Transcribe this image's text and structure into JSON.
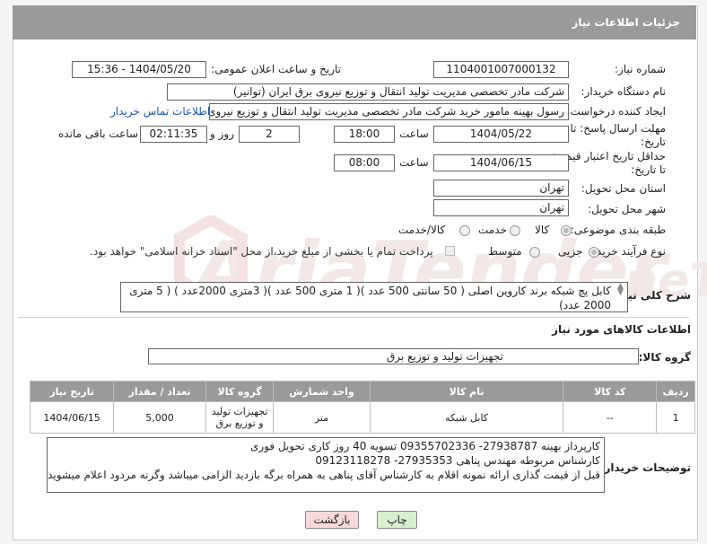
{
  "header": {
    "title": "جزئیات اطلاعات نیاز"
  },
  "form": {
    "need_number": {
      "label": "شماره نیاز:",
      "value": "1104001007000132"
    },
    "announce": {
      "label": "تاریخ و ساعت اعلان عمومی:",
      "value": "1404/05/20 - 15:36"
    },
    "buyer_org": {
      "label": "نام دستگاه خریدار:",
      "value": "شرکت مادر تخصصی مدیریت تولید  انتقال و توزیع نیروی برق ایران (توانیر)"
    },
    "requester": {
      "label": "ایجاد کننده درخواست:",
      "value": "رسول بهینه مامور خرید شرکت مادر تخصصی مدیریت تولید  انتقال و توزیع نیروی",
      "contact_link": "اطلاعات تماس خریدار"
    },
    "deadline": {
      "label_line1": "مهلت ارسال پاسخ: تا",
      "label_line2": "تاریخ:",
      "date": "1404/05/22",
      "time_label": "ساعت",
      "time": "18:00",
      "days": "2",
      "days_label": "روز و",
      "remaining": "02:11:35",
      "remaining_label": "ساعت باقی مانده"
    },
    "price_validity": {
      "label_line1": "حداقل تاریخ اعتبار قیمت:",
      "label_line2": "تا تاریخ:",
      "date": "1404/06/15",
      "time_label": "ساعت",
      "time": "08:00"
    },
    "province": {
      "label": "استان محل تحویل:",
      "value": "تهران"
    },
    "city": {
      "label": "شهر محل تحویل:",
      "value": "تهران"
    },
    "category": {
      "label": "طبقه بندی موضوعی:",
      "options": [
        "کالا",
        "خدمت",
        "کالا/خدمت"
      ],
      "selected": "کالا"
    },
    "process": {
      "label": "نوع فرآیند خرید :",
      "options": [
        "جزیی",
        "متوسط"
      ],
      "selected": "جزیی",
      "note": "پرداخت تمام یا بخشی از مبلغ خرید،از محل \"اسناد خزانه اسلامی\" خواهد بود."
    },
    "description": {
      "label": "شرح کلی نیاز:",
      "value": "کابل پچ شبکه برند کاروین اصلی  ( 50 سانتی 500 عدد )( 1 متری 500 عدد )( 3متری 2000عدد ) ( 5 متری 2000 عدد)"
    }
  },
  "goods_section": {
    "title": "اطلاعات کالاهای مورد نیاز",
    "group_label": "گروه کالا:",
    "group_value": "تجهیزات تولید و توزیع برق"
  },
  "table": {
    "headers": [
      "ردیف",
      "کد کالا",
      "نام کالا",
      "واحد شمارش",
      "گروه کالا",
      "تعداد / مقدار",
      "تاریخ نیاز"
    ],
    "rows": [
      [
        "1",
        "--",
        "کابل شبکه",
        "متر",
        "تجهیزات تولید و توزیع برق",
        "5,000",
        "1404/06/15"
      ]
    ]
  },
  "buyer_notes": {
    "label": "توضیحات خریدار:",
    "lines": [
      "کارپرداز بهینه 27938787- 09355702336  تسویه 40 روز کاری  تحویل فوری",
      "کارشناس مربوطه مهندس پناهی 27935353- 09123118278",
      "قبل از قیمت گذاری ارائه نمونه اقلام به کارشناس آقای پناهی به همراه برگه بازدید الزامی میباشد وگرنه مردود اعلام میشوید"
    ]
  },
  "buttons": {
    "print": "چاپ",
    "back": "بازگشت"
  },
  "colors": {
    "header": "#9a9a9a",
    "link": "#1a56b0",
    "print_btn": "#d8f0d0",
    "back_btn": "#f7d9d9"
  }
}
